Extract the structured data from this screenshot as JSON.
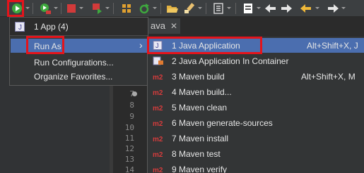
{
  "toolbar": {
    "icons": [
      "run-icon",
      "debug-icon",
      "stop-icon",
      "coverage-icon",
      "new-class-icon",
      "refresh-icon",
      "open-folder-icon",
      "brush-icon",
      "outline-icon",
      "task-icon",
      "back-icon",
      "forward-icon",
      "prev-edit-icon",
      "next-edit-icon"
    ]
  },
  "editor": {
    "tab_label": "ava",
    "tab_close": "✕",
    "line_numbers": [
      "7",
      "8",
      "9",
      "10",
      "11",
      "12",
      "13",
      "14"
    ]
  },
  "run_menu": {
    "header_label": "1 App (4)",
    "items": [
      {
        "label": "Run As",
        "has_submenu": true,
        "arrow": "›"
      },
      {
        "label": "Run Configurations..."
      },
      {
        "label": "Organize Favorites..."
      }
    ]
  },
  "run_as_menu": {
    "items": [
      {
        "label": "1 Java Application",
        "accelerator": "Alt+Shift+X, J",
        "icon": "java-app-icon"
      },
      {
        "label": "2 Java Application In Container",
        "accelerator": "",
        "icon": "container-icon"
      },
      {
        "label": "3 Maven build",
        "accelerator": "Alt+Shift+X, M",
        "icon": "maven-icon"
      },
      {
        "label": "4 Maven build...",
        "accelerator": "",
        "icon": "maven-icon"
      },
      {
        "label": "5 Maven clean",
        "accelerator": "",
        "icon": "maven-icon"
      },
      {
        "label": "6 Maven generate-sources",
        "accelerator": "",
        "icon": "maven-icon"
      },
      {
        "label": "7 Maven install",
        "accelerator": "",
        "icon": "maven-icon"
      },
      {
        "label": "8 Maven test",
        "accelerator": "",
        "icon": "maven-icon"
      },
      {
        "label": "9 Maven verify",
        "accelerator": "",
        "icon": "maven-icon"
      }
    ]
  },
  "colors": {
    "highlight_outline": "#e4141b",
    "selection": "#4b6eaf",
    "menu_bg": "#333536",
    "run_green": "#3ea83e"
  }
}
